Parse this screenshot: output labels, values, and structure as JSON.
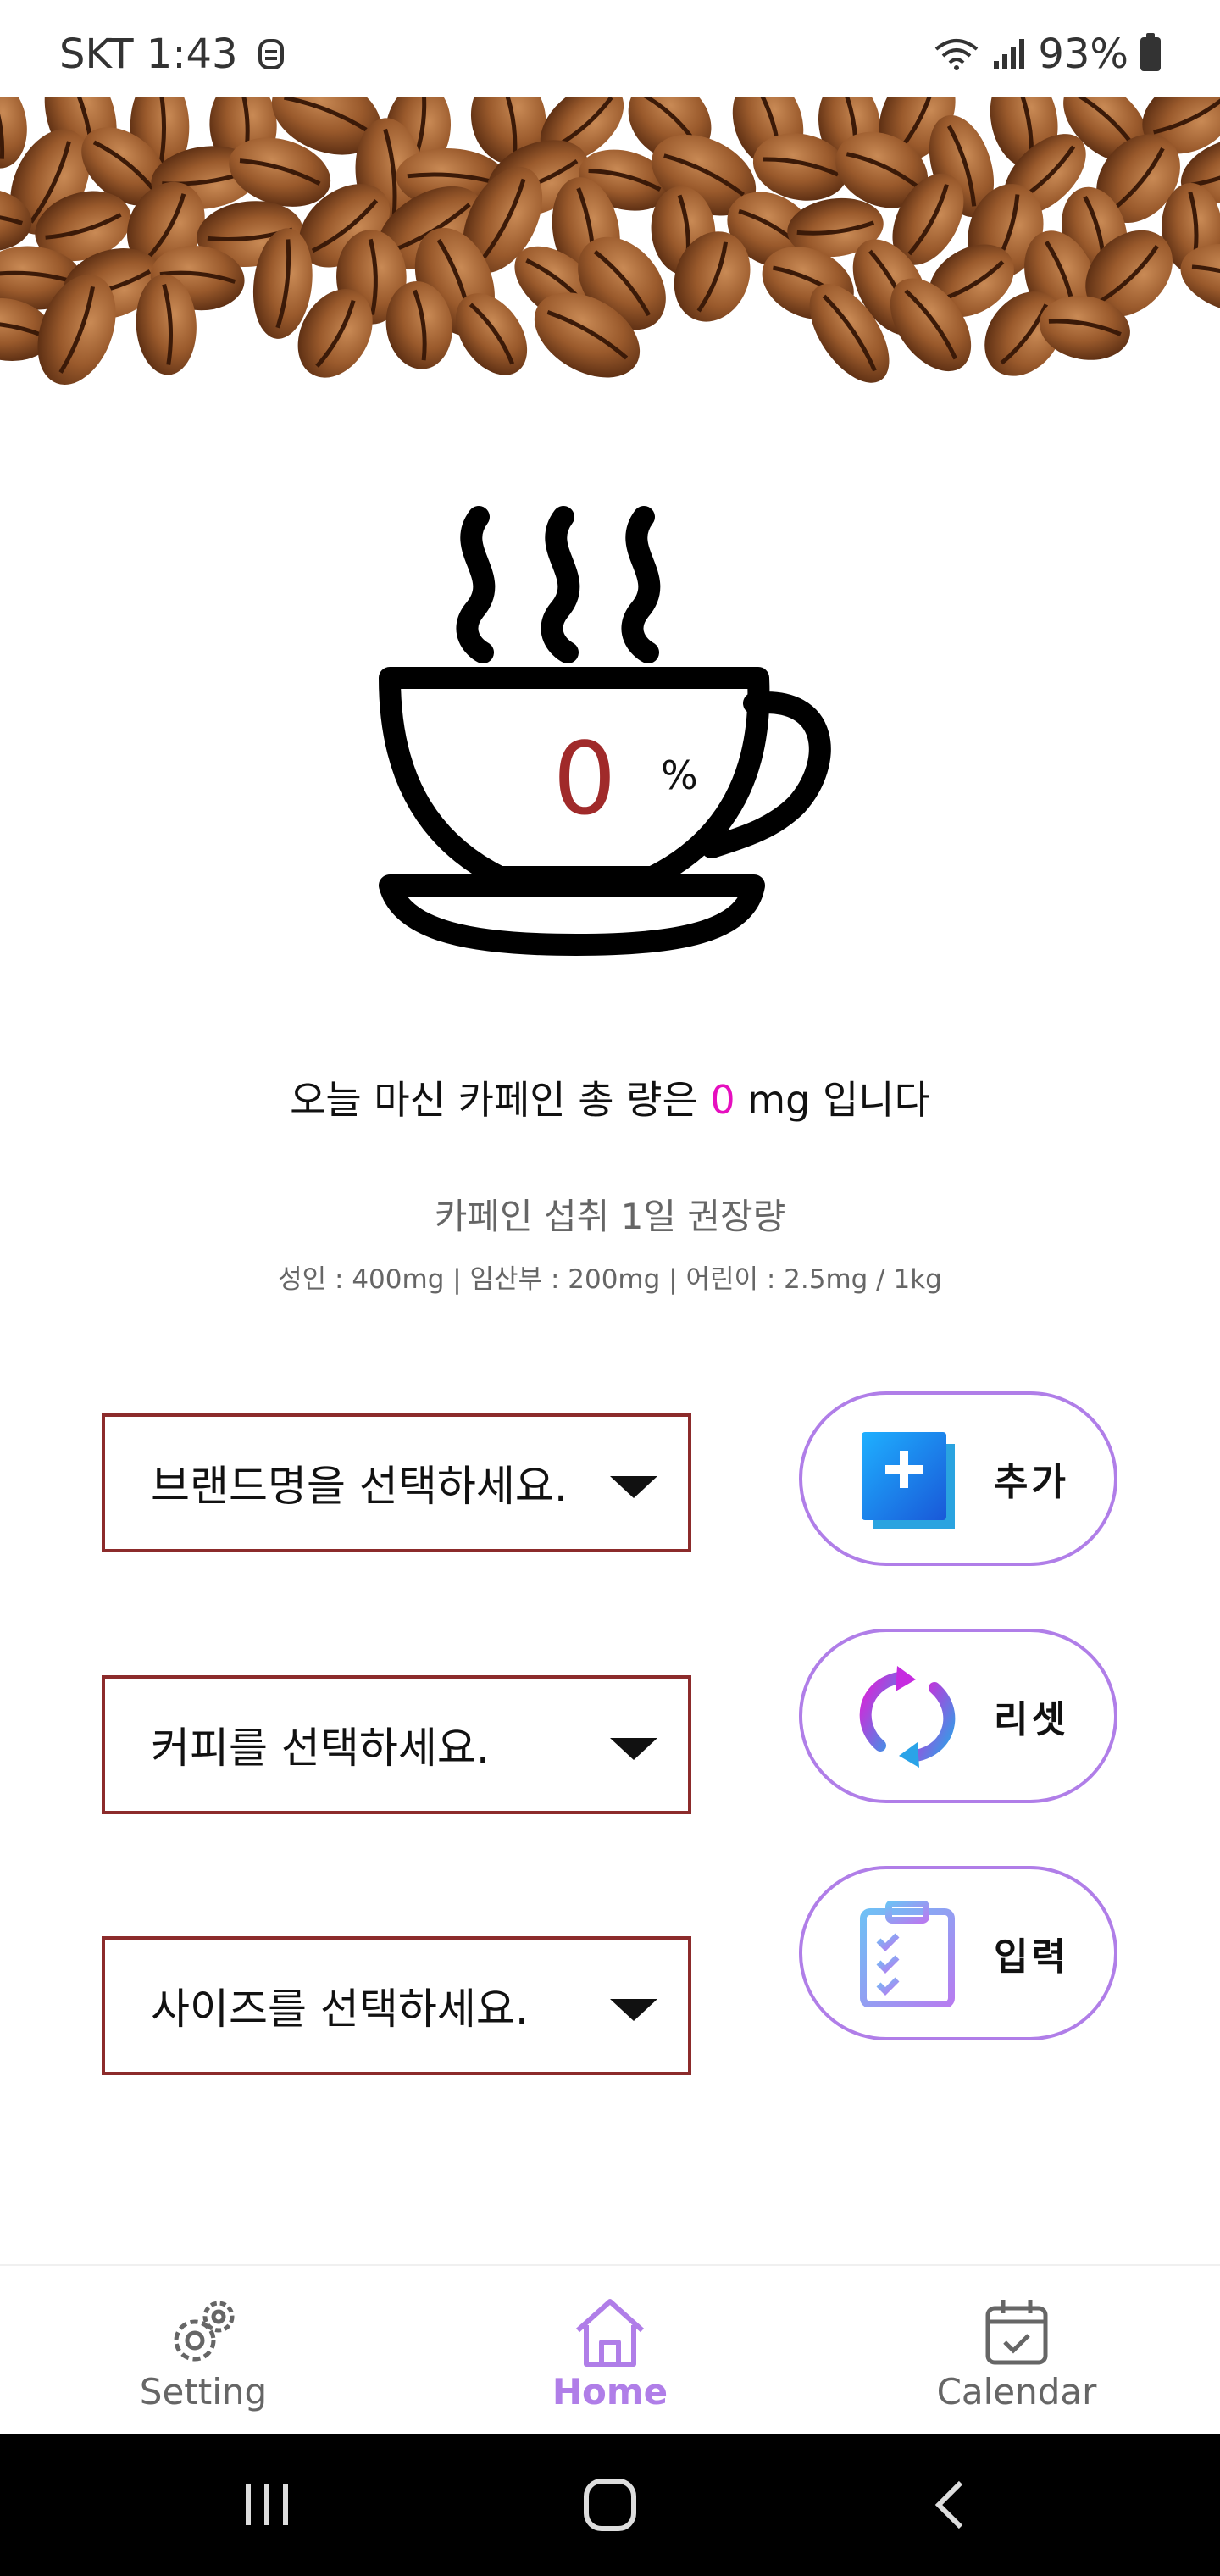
{
  "status_bar": {
    "carrier_time": "SKT 1:43",
    "battery": "93%",
    "icons": [
      "notification-icon",
      "wifi-icon",
      "signal-icon",
      "battery-icon"
    ]
  },
  "cup": {
    "percent_value": "0",
    "percent_unit": "%"
  },
  "summary": {
    "prefix": "오늘 마신 카페인 총 량은 ",
    "value": "0",
    "suffix": " mg 입니다"
  },
  "recommendation": {
    "title": "카페인 섭취 1일 권장량",
    "detail": "성인 : 400mg | 임산부 : 200mg | 어린이 : 2.5mg / 1kg"
  },
  "selects": {
    "brand": "브랜드명을 선택하세요.",
    "coffee": "커피를 선택하세요.",
    "size": "사이즈를 선택하세요."
  },
  "actions": {
    "add": "추가",
    "reset": "리셋",
    "input": "입력"
  },
  "bottom_nav": {
    "setting": "Setting",
    "home": "Home",
    "calendar": "Calendar",
    "active": "home"
  },
  "colors": {
    "accent": "#b07ee8",
    "select_border": "#8c2b2b",
    "cup_value": "#a02a2a",
    "summary_value": "#e60fbf"
  }
}
